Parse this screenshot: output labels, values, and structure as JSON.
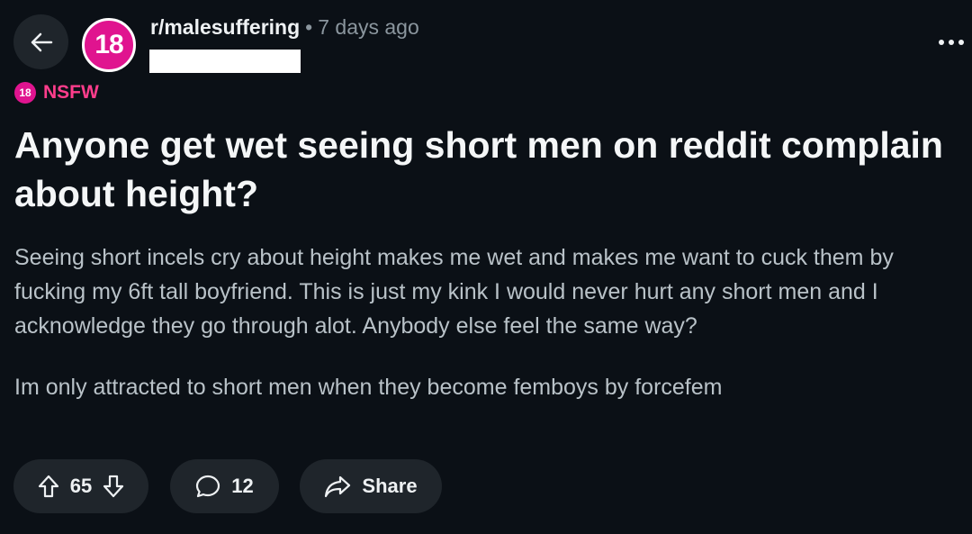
{
  "header": {
    "subreddit": "r/malesuffering",
    "separator": "•",
    "age": "7 days ago",
    "avatar_text": "18"
  },
  "post": {
    "nsfw_badge": "18",
    "nsfw_label": "NSFW",
    "title": "Anyone get wet seeing short men on reddit complain about height?",
    "body": [
      "Seeing short incels cry about height makes me wet and makes me want to cuck them by fucking my 6ft tall boyfriend. This is just my kink I would never hurt any short men and I acknowledge they go through alot. Anybody else feel the same way?",
      "Im only attracted to short men when they become femboys by forcefem"
    ]
  },
  "actions": {
    "votes": "65",
    "comments": "12",
    "share_label": "Share"
  },
  "colors": {
    "background": "#0b1016",
    "pill": "#1f252b",
    "nsfw_accent": "#ff3d8c",
    "avatar": "#e0148f"
  }
}
